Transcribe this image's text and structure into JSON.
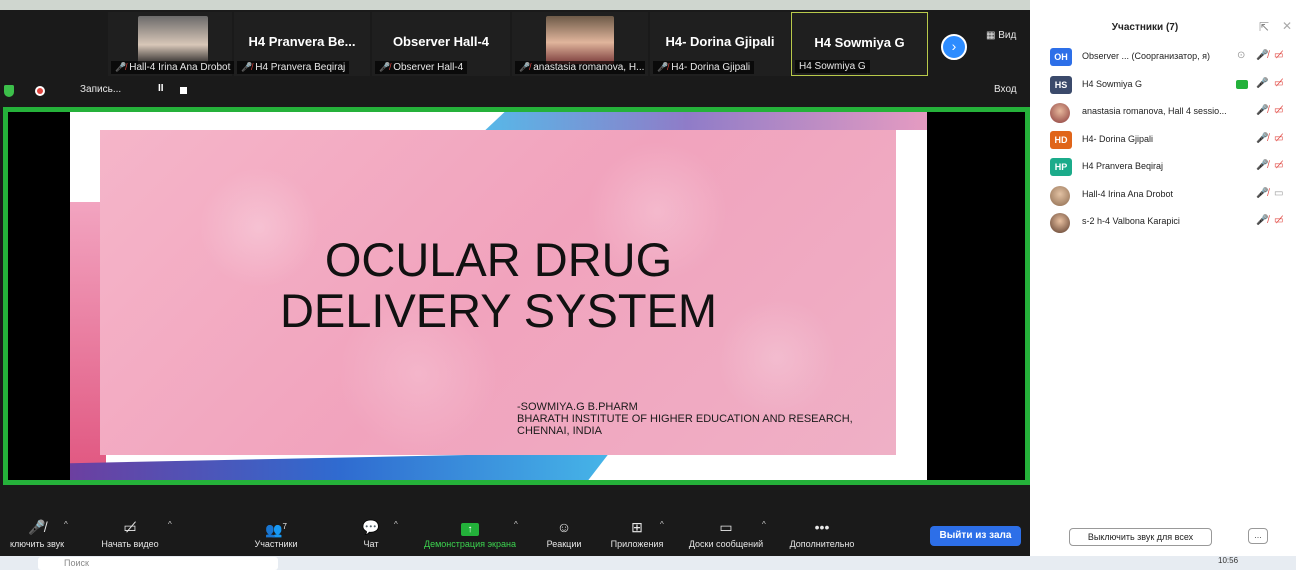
{
  "window": {
    "top_title": ""
  },
  "gallery": {
    "tiles": [
      {
        "name": "",
        "subtitle": "Hall-4 Irina Ana Drobot"
      },
      {
        "name": "H4 Pranvera Be...",
        "subtitle": "H4 Pranvera Beqiraj"
      },
      {
        "name": "Observer Hall-4",
        "subtitle": "Observer Hall-4"
      },
      {
        "name": "",
        "subtitle": "anastasia romanova, H..."
      },
      {
        "name": "H4- Dorina Gjipali",
        "subtitle": "H4- Dorina Gjipali"
      },
      {
        "name": "H4 Sowmiya G",
        "subtitle": "H4 Sowmiya G"
      }
    ],
    "view_label": "Вид"
  },
  "recording": {
    "label": "Запись...",
    "exit_label": "Вход"
  },
  "slide": {
    "title_line1": "OCULAR DRUG",
    "title_line2": "DELIVERY SYSTEM",
    "author_line1": "-SOWMIYA.G B.PHARM",
    "author_line2": "BHARATH INSTITUTE OF HIGHER EDUCATION AND RESEARCH,",
    "author_line3": "CHENNAI, INDIA"
  },
  "toolbar": {
    "mute_label": "ключить звук",
    "video_label": "Начать видео",
    "participants_label": "Участники",
    "participants_count": "7",
    "chat_label": "Чат",
    "share_label": "Демонстрация экрана",
    "reactions_label": "Реакции",
    "apps_label": "Приложения",
    "whiteboards_label": "Доски сообщений",
    "more_label": "Дополнительно",
    "leave_label": "Выйти из зала"
  },
  "panel": {
    "title": "Участники (7)",
    "participants": [
      {
        "initials": "OH",
        "name": "Observer ... (Соорганизатор, я)",
        "color": "#2d6fe8"
      },
      {
        "initials": "HS",
        "name": "H4 Sowmiya G",
        "color": "#3b4a6b"
      },
      {
        "initials": "",
        "name": "anastasia romanova, Hall 4 sessio...",
        "color": "#c46a5a"
      },
      {
        "initials": "HD",
        "name": "H4- Dorina Gjipali",
        "color": "#e0651a"
      },
      {
        "initials": "HP",
        "name": "H4 Pranvera Beqiraj",
        "color": "#1bab8a"
      },
      {
        "initials": "",
        "name": "Hall-4 Irina Ana Drobot",
        "color": "#b58c6a"
      },
      {
        "initials": "",
        "name": "s-2 h-4 Valbona Karapici",
        "color": "#8a5a3e"
      }
    ],
    "mute_all_label": "Выключить звук для всех",
    "more_label": "..."
  },
  "taskbar": {
    "search_placeholder": "Поиск",
    "clock": "10:56"
  },
  "colors": {
    "share_border": "#25b13a",
    "leave_button": "#2d6fe8",
    "mute_red": "#e0443e",
    "accent_blue": "#2d8cff"
  }
}
